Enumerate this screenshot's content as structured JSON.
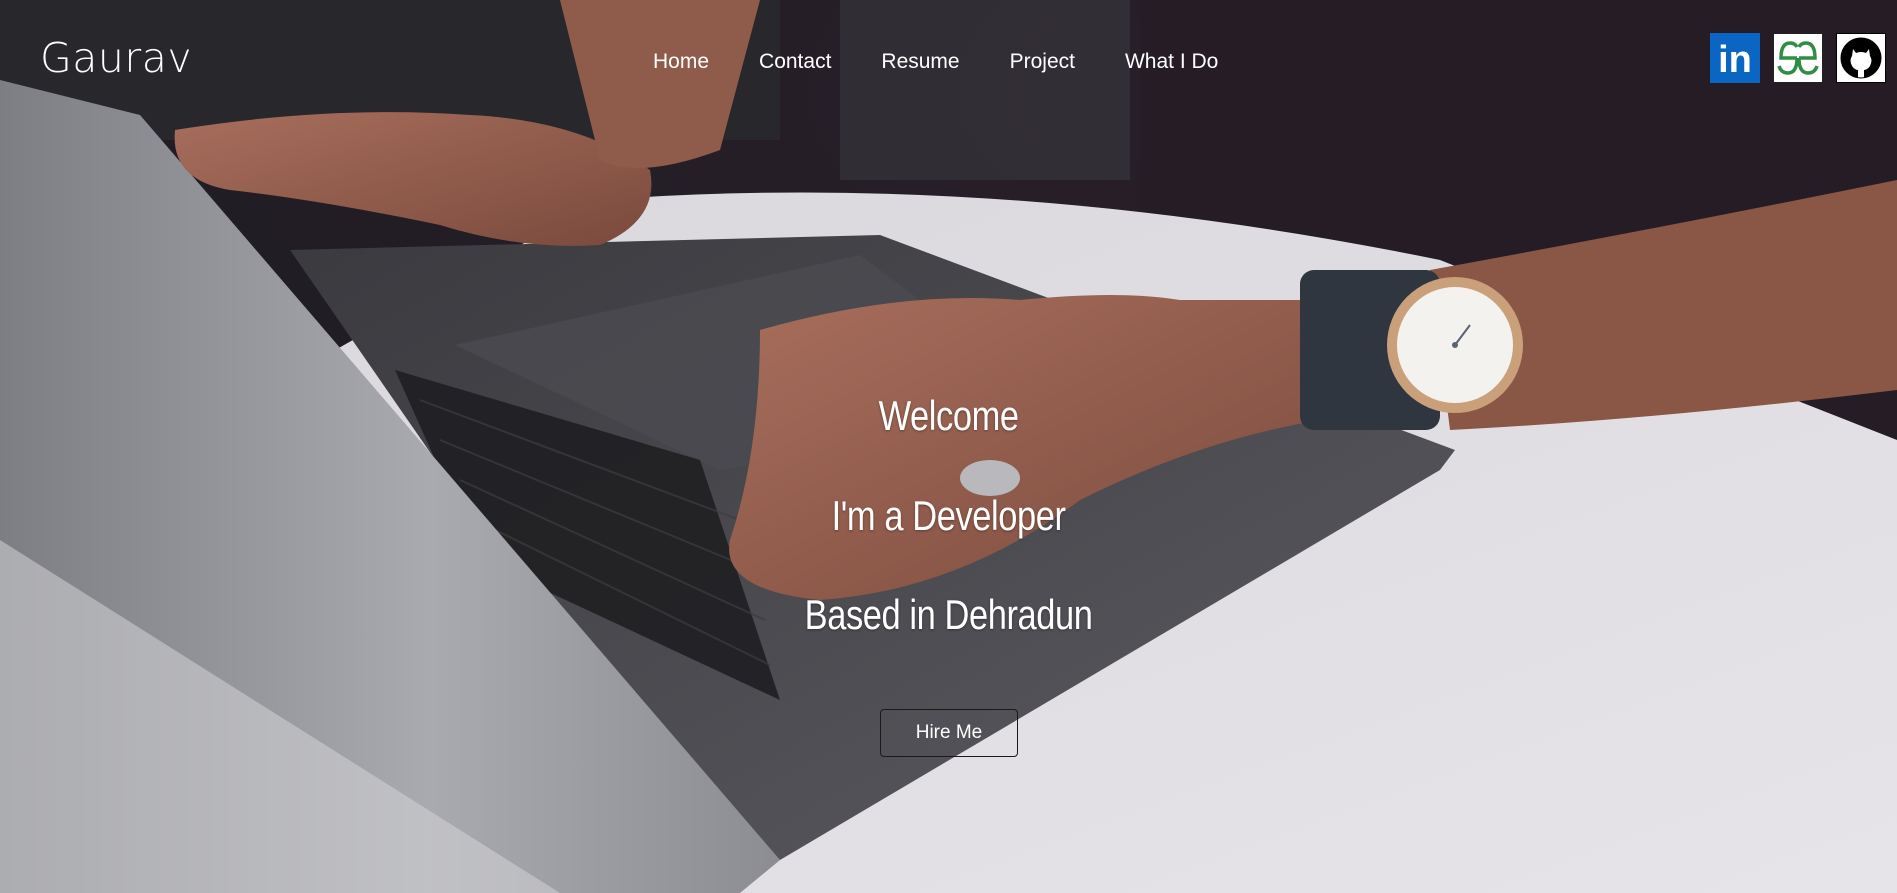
{
  "brand": {
    "name": "Gaurav"
  },
  "nav": {
    "items": [
      {
        "label": "Home"
      },
      {
        "label": "Contact"
      },
      {
        "label": "Resume"
      },
      {
        "label": "Project"
      },
      {
        "label": "What I Do"
      }
    ]
  },
  "social": {
    "links": [
      {
        "icon": "linkedin-icon",
        "text": "in",
        "color": "#0a66c2"
      },
      {
        "icon": "geeksforgeeks-icon",
        "color": "#2f8d46"
      },
      {
        "icon": "github-icon",
        "color": "#000000"
      }
    ]
  },
  "hero": {
    "line1": "Welcome",
    "line2": "I'm a Developer",
    "line3": "Based in Dehradun",
    "cta_label": "Hire Me"
  }
}
